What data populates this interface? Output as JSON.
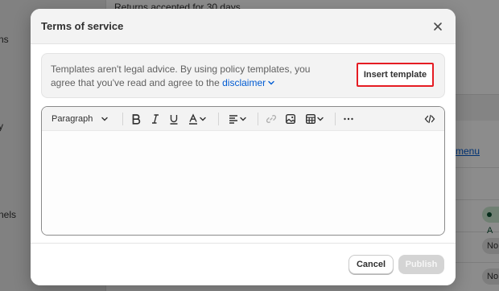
{
  "background": {
    "top_text": "Returns accepted for 30 days",
    "nav_fragments": [
      "ns",
      "y",
      "nels"
    ],
    "link_fragment": "menu",
    "status_pill": "A",
    "pill_fragments": [
      "No",
      "No"
    ]
  },
  "modal": {
    "title": "Terms of service",
    "close_icon": "close-icon",
    "notice": {
      "text": "Templates aren't legal advice. By using policy templates, you agree that you've read and agree to the ",
      "link": "disclaimer",
      "insert_button": "Insert template"
    },
    "toolbar": {
      "paragraph_label": "Paragraph",
      "icons": [
        "bold-icon",
        "italic-icon",
        "underline-icon",
        "text-color-icon",
        "align-icon",
        "link-icon",
        "image-icon",
        "table-icon",
        "more-icon",
        "code-icon"
      ]
    },
    "editor_content": "",
    "footer": {
      "cancel_label": "Cancel",
      "publish_label": "Publish"
    }
  },
  "colors": {
    "accent_link": "#005bd3",
    "highlight_border": "#e51c23",
    "publish_disabled": "#d4d4d4"
  }
}
